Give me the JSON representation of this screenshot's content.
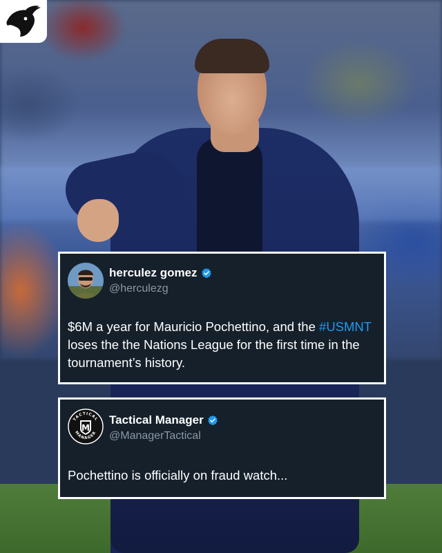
{
  "tweets": [
    {
      "name": "herculez gomez",
      "handle": "@herculezg",
      "text_before": "$6M a year for Mauricio Pochettino, and the ",
      "hashtag": "#USMNT",
      "text_after": " loses the the Nations League for the first time in the tournament’s history."
    },
    {
      "name": "Tactical Manager",
      "handle": "@ManagerTactical",
      "text": "Pochettino is officially on fraud watch...",
      "avatar_text": "TACTICAL MANAGER",
      "avatar_monogram": "M"
    }
  ],
  "icons": {
    "logo": "goat-head-icon",
    "verified": "verified-badge-icon"
  },
  "colors": {
    "card_bg": "#15202b",
    "hashtag": "#1d9bf0",
    "verified": "#1d9bf0",
    "handle": "#8b98a5"
  }
}
